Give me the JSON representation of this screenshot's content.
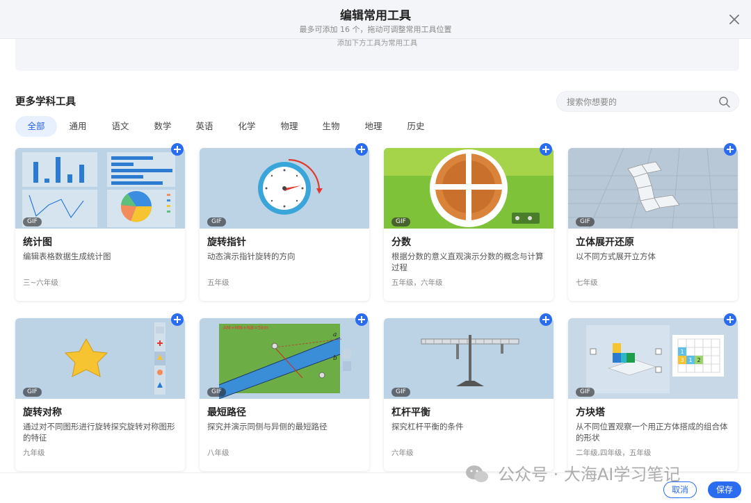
{
  "header": {
    "title": "编辑常用工具",
    "subtitle": "最多可添加 16 个，拖动可调整常用工具位置",
    "selected_hint": "添加下方工具为常用工具"
  },
  "more_tools": {
    "title": "更多学科工具",
    "search_placeholder": "搜索你想要的"
  },
  "tabs": [
    {
      "label": "全部",
      "active": true
    },
    {
      "label": "通用"
    },
    {
      "label": "语文"
    },
    {
      "label": "数学"
    },
    {
      "label": "英语"
    },
    {
      "label": "化学"
    },
    {
      "label": "物理"
    },
    {
      "label": "生物"
    },
    {
      "label": "地理"
    },
    {
      "label": "历史"
    }
  ],
  "tools": [
    {
      "title": "统计图",
      "desc": "编辑表格数据生成统计图",
      "grade": "三~六年级",
      "badge": "GIF"
    },
    {
      "title": "旋转指针",
      "desc": "动态演示指针旋转的方向",
      "grade": "五年级",
      "badge": "GIF"
    },
    {
      "title": "分数",
      "desc": "根据分数的意义直观演示分数的概念与计算过程",
      "grade": "五年级，六年级",
      "badge": "GIF"
    },
    {
      "title": "立体展开还原",
      "desc": "以不同方式展开立方体",
      "grade": "七年级",
      "badge": "GIF"
    },
    {
      "title": "旋转对称",
      "desc": "通过对不同图形进行旋转探究旋转对称图形的特征",
      "grade": "九年级",
      "badge": "GIF"
    },
    {
      "title": "最短路径",
      "desc": "探究并演示同侧与异侧的最短路径",
      "grade": "八年级",
      "badge": "GIF"
    },
    {
      "title": "杠杆平衡",
      "desc": "探究杠杆平衡的条件",
      "grade": "六年级",
      "badge": "GIF"
    },
    {
      "title": "方块塔",
      "desc": "从不同位置观察一个用正方体搭成的组合体的形状",
      "grade": "二年级,四年级，五年级",
      "badge": "GIF"
    }
  ],
  "thumb_text": {
    "path_formula": "AM+MN+NB=5km",
    "path_a": "a",
    "path_b": "b",
    "cube_cells": [
      "1",
      "3",
      "1",
      "2"
    ]
  },
  "footer": {
    "cancel_label": "取消",
    "save_label": "保存",
    "watermark": "公众号 · 大海AI学习笔记"
  },
  "colors": {
    "accent": "#2a6cf0",
    "active_tab_bg": "#e9f0fd"
  },
  "icons": [
    "close-icon",
    "search-icon",
    "add-icon",
    "wechat-icon"
  ]
}
